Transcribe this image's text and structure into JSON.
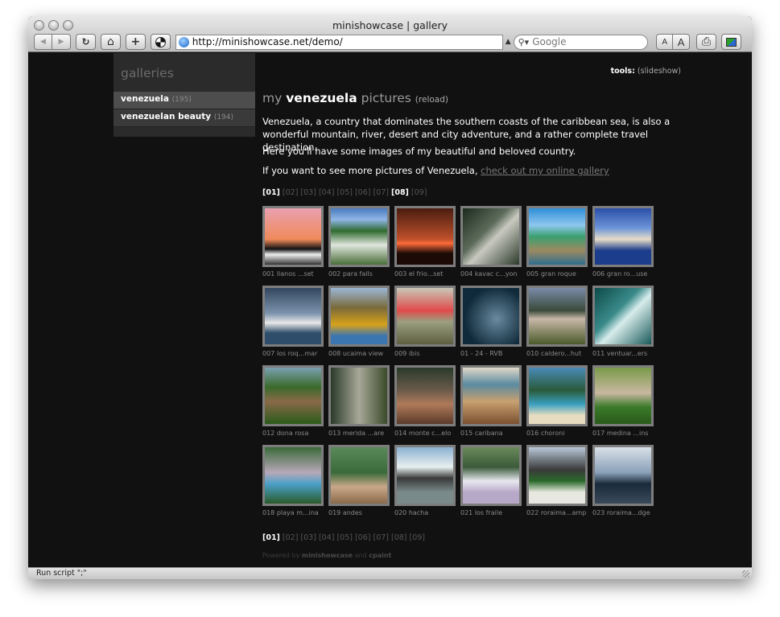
{
  "window": {
    "title": "minishowcase | gallery",
    "status": "Run script \";\""
  },
  "toolbar": {
    "url": "http://minishowcase.net/demo/",
    "search_placeholder": "Google",
    "back_icon": "◀",
    "forward_icon": "▶",
    "reload_icon": "↻",
    "home_icon": "⌂",
    "add_icon": "+",
    "font_small": "A",
    "font_large": "A",
    "print_icon": "⎙"
  },
  "sidebar": {
    "heading": "galleries",
    "items": [
      {
        "label": "venezuela",
        "count": "(195)"
      },
      {
        "label": "venezuelan beauty",
        "count": "(194)"
      }
    ]
  },
  "tools": {
    "label": "tools:",
    "link": "(slideshow)"
  },
  "header": {
    "pre": "my ",
    "name": "venezuela",
    "post": " pictures ",
    "reload": "(reload)"
  },
  "intro": {
    "p1": "Venezuela, a country that dominates the southern coasts of the caribbean sea, is also a wonderful mountain, river, desert and city adventure, and a rather complete travel destination.",
    "p2": "Here you'll have some images of my beautiful and beloved country.",
    "p3_pre": "If you want to see more pictures of Venezuela, ",
    "p3_link": "check out my online gallery"
  },
  "pager_top": [
    "[01]",
    "[02]",
    "[03]",
    "[04]",
    "[05]",
    "[06]",
    "[07]",
    "[08]",
    "[09]"
  ],
  "pager_bottom": [
    "[01]",
    "[02]",
    "[03]",
    "[04]",
    "[05]",
    "[06]",
    "[07]",
    "[08]",
    "[09]"
  ],
  "thumbs": [
    {
      "caption": "001 llanos ...set",
      "bg": "linear-gradient(#e9a0b0 0%, #f08a5a 55%, #111 72%, #eee 82%, #333 100%)"
    },
    {
      "caption": "002 para falls",
      "bg": "linear-gradient(#4a7bbf 0%, #8fb6e6 20%, #2f6b2f 40%, #dfe5dc 65%, #4a6f3a 100%)"
    },
    {
      "caption": "003 el frio...set",
      "bg": "linear-gradient(#4a1d10 0%, #c0502a 55%, #ff6b3a 62%, #1b0a06 80%)"
    },
    {
      "caption": "004 kavac c...yon",
      "bg": "linear-gradient(135deg, #1c2a1c, #5c6b5a 40%, #c9c9c0 55%, #2b3a2b)"
    },
    {
      "caption": "005 gran roque",
      "bg": "linear-gradient(#2f8fd8 0%, #8ec7ef 30%, #3aa070 50%, #9c8a60 75%, #2e6e8f 100%)"
    },
    {
      "caption": "006 gran ro...use",
      "bg": "linear-gradient(#2a4fa8 0%, #6d95d8 35%, #e8dcc8 55%, #1c3c8c 75%)"
    },
    {
      "caption": "007 los roq...mar",
      "bg": "linear-gradient(#33475f 0%, #7c93ad 45%, #e8e8e8 62%, #2d4d6a 80%)"
    },
    {
      "caption": "008 ucaima view",
      "bg": "linear-gradient(#9bb7d7 0%, #7a6a3a 35%, #d7a21a 65%, #3c76b0 85%)"
    },
    {
      "caption": "009 ibis",
      "bg": "linear-gradient(#c8c8b8 0%, #e04a4a 40%, #9aa080 60%, #5e5e40 100%)"
    },
    {
      "caption": "01 - 24 - RVB",
      "bg": "radial-gradient(circle at 60% 55%, #6a8aa0, #0f2a3a 70%)"
    },
    {
      "caption": "010 caldero...hut",
      "bg": "linear-gradient(#7a8aa8 0%, #3a4a3a 40%, #c8b8a8 55%, #4a5a2a 100%)"
    },
    {
      "caption": "011 ventuar...ers",
      "bg": "linear-gradient(135deg, #0d4a4a, #3a8a8a 40%, #d8ecec 55%, #1a5a5a)"
    },
    {
      "caption": "012 dona rosa",
      "bg": "linear-gradient(#7aa0b0 0%, #3a6a2a 35%, #8a6a4a 60%, #2a5a1a 100%)"
    },
    {
      "caption": "013 merida ...are",
      "bg": "linear-gradient(90deg, #2a3a2a, #a8a898 50%, #3a4a2a)"
    },
    {
      "caption": "014 monte c...elo",
      "bg": "linear-gradient(#2a3a2a 0%, #6a5a4a 40%, #b07a5a 65%, #5a3a2a 100%)"
    },
    {
      "caption": "015 caribana",
      "bg": "linear-gradient(#e0d8c8 0%, #5a8aa0 30%, #c8a070 60%, #7a5030 100%)"
    },
    {
      "caption": "016 choroni",
      "bg": "linear-gradient(#4a8ab8 0%, #2a5a3a 40%, #3aa0c0 65%, #e8dcc0 85%)"
    },
    {
      "caption": "017 medina ...ins",
      "bg": "linear-gradient(#7a9a4a 0%, #c8b8a0 45%, #3a7a2a 70%, #2a5a1a 100%)"
    },
    {
      "caption": "018 playa m...ina",
      "bg": "linear-gradient(#3a6a3a 0%, #b8a8b8 45%, #4aa0c8 65%, #2a5a2a 100%)"
    },
    {
      "caption": "019 andes",
      "bg": "linear-gradient(#5a8a5a 0%, #3a6a3a 45%, #c8a888 70%, #8a6a4a 100%)"
    },
    {
      "caption": "020 hacha",
      "bg": "linear-gradient(#8ab0d0 0%, #e8f0f0 35%, #3a3a3a 55%, #7a8a8a 80%)"
    },
    {
      "caption": "021 los fraile",
      "bg": "linear-gradient(#6a8a5a 0%, #3a5a3a 35%, #e8e8f0 60%, #b8a8c8 80%)"
    },
    {
      "caption": "022 roraima...amp",
      "bg": "linear-gradient(#b8c8d8 0%, #3a3a3a 40%, #2a6a2a 60%, #e8e8e0 80%)"
    },
    {
      "caption": "023 roraima...dge",
      "bg": "linear-gradient(#d8e0e8 0%, #8aa0b8 45%, #1a2a3a 65%, #3a4a5a 100%)"
    }
  ],
  "footer": {
    "pre": "Powered by ",
    "brand1": "minishowcase",
    "mid": " and ",
    "brand2": "cpaint"
  }
}
